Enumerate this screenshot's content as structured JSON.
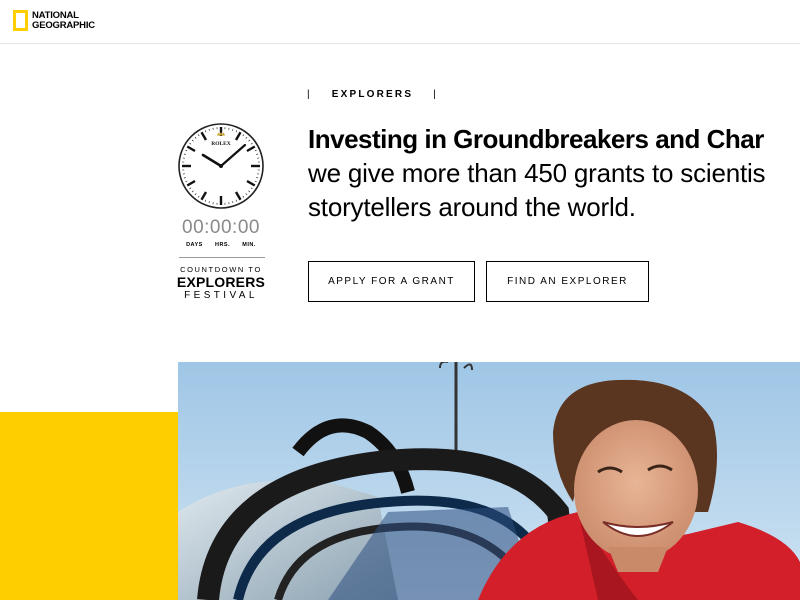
{
  "header": {
    "logo_line1": "NATIONAL",
    "logo_line2": "GEOGRAPHIC",
    "logo_color": "#FFCE00"
  },
  "countdown": {
    "watch_brand": "ROLEX",
    "time": "00:00:00",
    "units": [
      "DAYS",
      "HRS.",
      "MIN."
    ],
    "label_line1": "COUNTDOWN TO",
    "label_line2": "EXPLORERS",
    "label_line3": "FESTIVAL"
  },
  "hero": {
    "eyebrow": "EXPLORERS",
    "headline_bold": "Investing in Groundbreakers and Char",
    "headline_line2": "we give more than 450 grants to scientis",
    "headline_line3": "storytellers around the world.",
    "apply_button": "APPLY FOR A GRANT",
    "find_button": "FIND AN EXPLORER"
  },
  "colors": {
    "accent_yellow": "#FFCE00",
    "countdown_gray": "#8a8a8a"
  },
  "photo": {
    "subject_icon": "explorer-portrait-photo"
  }
}
